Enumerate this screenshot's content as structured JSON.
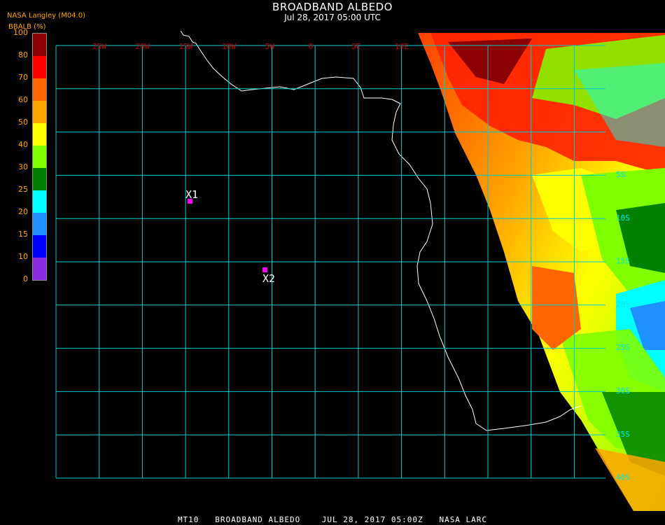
{
  "header": {
    "title": "BROADBAND ALBEDO",
    "subtitle": "Jul 28, 2017 05:00 UTC",
    "agency": "NASA Langley (M04.0)",
    "units": "BBALB (%)"
  },
  "colorbar": {
    "ticks": [
      "0",
      "10",
      "15",
      "20",
      "25",
      "30",
      "40",
      "50",
      "60",
      "70",
      "80",
      "100"
    ],
    "colors": [
      "#8a2be2",
      "#0000ff",
      "#1e90ff",
      "#00ffff",
      "#008000",
      "#7fff00",
      "#ffff00",
      "#ffa500",
      "#ff6600",
      "#ff0000",
      "#8b0000"
    ]
  },
  "map": {
    "grid_color": "#00cccc",
    "lon_labels": [
      "25W",
      "20W",
      "15W",
      "10W",
      "5W",
      "0",
      "5E",
      "10E"
    ],
    "lat_labels": [
      "5S",
      "10S",
      "15S",
      "20S",
      "25S",
      "30S",
      "35S",
      "40S"
    ],
    "markers": [
      {
        "label": "X1",
        "color": "#ff00ff"
      },
      {
        "label": "X2",
        "color": "#ff00ff"
      }
    ]
  },
  "footer": "MT10   BROADBAND ALBEDO    JUL 28, 2017 05:00Z   NASA LARC"
}
